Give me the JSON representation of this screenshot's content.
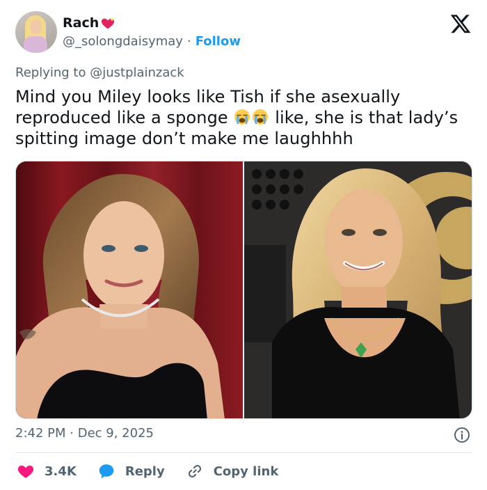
{
  "author": {
    "name": "Rach",
    "handle": "@_solongdaisymay",
    "separator": "·",
    "follow_label": "Follow"
  },
  "replying": {
    "prefix": "Replying to",
    "mention": "@justplainzack"
  },
  "tweet": {
    "text_part1": "Mind you Miley looks like Tish if she asexually reproduced like a sponge",
    "text_part2": "like, she is that lady’s spitting image don’t make me laughhhh"
  },
  "meta": {
    "time": "2:42 PM",
    "separator": "·",
    "date": "Dec 9, 2025"
  },
  "actions": {
    "like_count": "3.4K",
    "reply_label": "Reply",
    "copy_link_label": "Copy link"
  },
  "colors": {
    "accent": "#1d9bf0",
    "like": "#f91880",
    "muted": "#536471",
    "text": "#0f1419"
  },
  "icons": {
    "logo": "x-logo-icon",
    "heart_badge": "red-heart-icon",
    "emoji": "loudly-crying-face-icon",
    "like": "heart-icon",
    "reply": "speech-bubble-icon",
    "copy": "link-icon",
    "info": "info-icon"
  }
}
